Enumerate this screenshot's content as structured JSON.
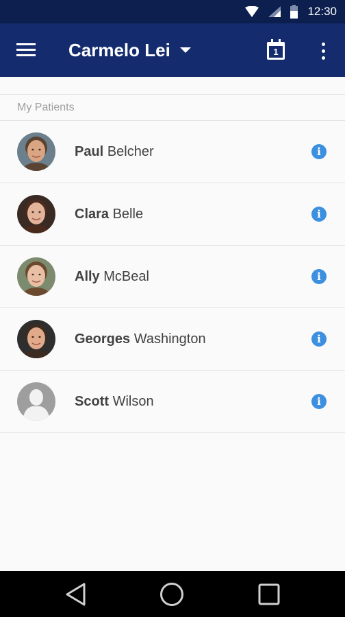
{
  "status_bar": {
    "time": "12:30",
    "icons": [
      "wifi-icon",
      "signal-icon",
      "battery-icon"
    ]
  },
  "app_bar": {
    "title": "Carmelo Lei",
    "calendar_day": "1",
    "icons": [
      "menu-icon",
      "dropdown-caret-icon",
      "calendar-icon",
      "more-vert-icon"
    ]
  },
  "section": {
    "label": "My Patients"
  },
  "patients": [
    {
      "first": "Paul",
      "last": "Belcher",
      "avatar": "photo",
      "skin": "#d9a582",
      "hair": "#5a4332",
      "bg": "#6b7f8c"
    },
    {
      "first": "Clara",
      "last": "Belle",
      "avatar": "photo",
      "skin": "#e3b39a",
      "hair": "#4a2a1c",
      "bg": "#3a2a24"
    },
    {
      "first": "Ally",
      "last": "McBeal",
      "avatar": "photo",
      "skin": "#e8bfa4",
      "hair": "#6b4a30",
      "bg": "#7c8a6e"
    },
    {
      "first": "Georges",
      "last": "Washington",
      "avatar": "photo",
      "skin": "#e0a98a",
      "hair": "#3b2b20",
      "bg": "#2e2e2e"
    },
    {
      "first": "Scott",
      "last": "Wilson",
      "avatar": "placeholder",
      "skin": "#f2f2f2",
      "hair": "#bdbdbd",
      "bg": "#9e9e9e"
    }
  ],
  "nav_bar": {
    "icons": [
      "back-icon",
      "home-icon",
      "recents-icon"
    ]
  },
  "colors": {
    "status_bar": "#0c1f4f",
    "app_bar": "#142b6e",
    "accent_info": "#3d8fe0",
    "background": "#fafafa"
  }
}
